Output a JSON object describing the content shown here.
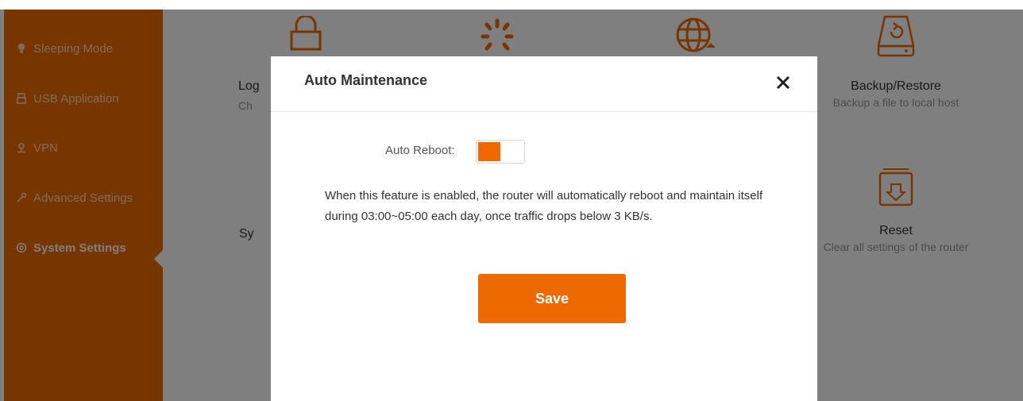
{
  "sidebar": {
    "items": [
      {
        "label": "Sleeping Mode",
        "icon": "bulb-icon"
      },
      {
        "label": "USB Application",
        "icon": "usb-icon"
      },
      {
        "label": "VPN",
        "icon": "vpn-icon"
      },
      {
        "label": "Advanced Settings",
        "icon": "wrench-icon"
      },
      {
        "label": "System Settings",
        "icon": "gear-icon"
      }
    ],
    "active_item": "System Settings"
  },
  "tiles": {
    "login": {
      "title": "Log",
      "desc": "Ch"
    },
    "backup": {
      "title": "Backup/Restore",
      "desc": "Backup a file to local host"
    },
    "system": {
      "title": "Sy"
    },
    "reset": {
      "title": "Reset",
      "desc": "Clear all settings of the router"
    }
  },
  "modal": {
    "title": "Auto Maintenance",
    "auto_reboot_label": "Auto Reboot:",
    "auto_reboot_enabled": true,
    "description": "When this feature is enabled, the router will automatically reboot and maintain itself during 03:00~05:00 each day, once traffic drops below 3 KB/s.",
    "save_label": "Save"
  },
  "colors": {
    "accent": "#ee6a00",
    "sidebar_text": "#ffd9b8",
    "overlay": "rgba(0,0,0,0.5)"
  }
}
